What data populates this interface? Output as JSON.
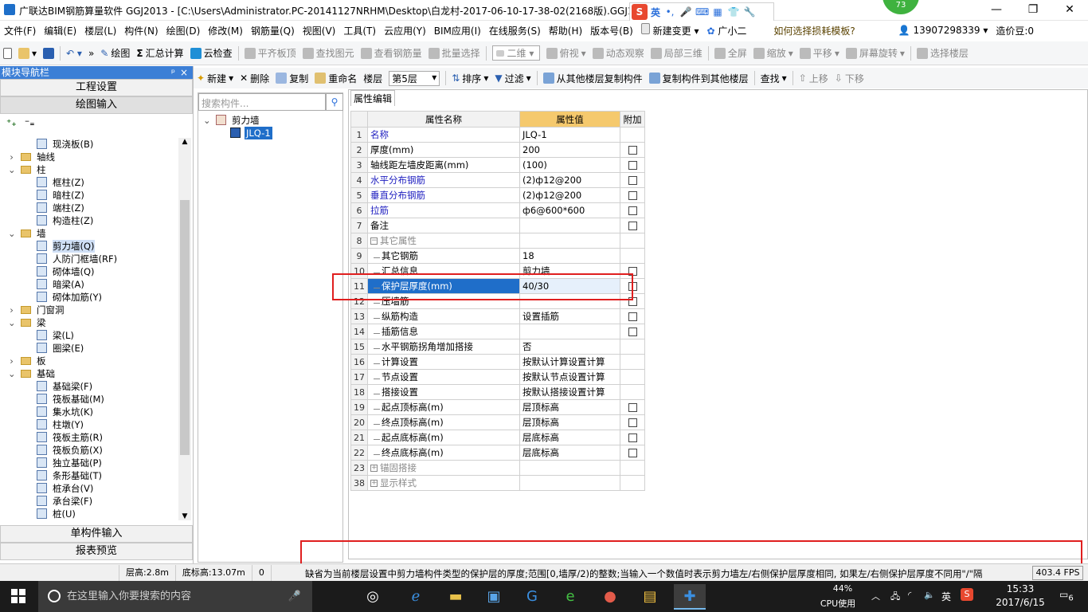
{
  "window": {
    "title": "广联达BIM钢筋算量软件 GGJ2013 - [C:\\Users\\Administrator.PC-20141127NRHM\\Desktop\\白龙村-2017-06-10-17-38-02(2168版).GGJ12]",
    "minimize": "—",
    "restore": "❐",
    "close": "✕"
  },
  "ime": {
    "logo": "S",
    "lang": "英"
  },
  "badge": {
    "value": "73"
  },
  "menu": {
    "items": [
      "文件(F)",
      "编辑(E)",
      "楼层(L)",
      "构件(N)",
      "绘图(D)",
      "修改(M)",
      "钢筋量(Q)",
      "视图(V)",
      "工具(T)",
      "云应用(Y)",
      "BIM应用(I)",
      "在线服务(S)",
      "帮助(H)",
      "版本号(B)"
    ],
    "new_change": "新建变更",
    "assistant": "广小二",
    "help_link": "如何选择损耗模板?",
    "phone": "13907298339",
    "coins": "造价豆:0"
  },
  "toolbar": {
    "draw": "绘图",
    "sum": "汇总计算",
    "cloud_check": "云检查",
    "flat_slab": "平齐板顶",
    "find_element": "查找图元",
    "view_rebar": "查看钢筋量",
    "batch_select": "批量选择",
    "view_2d": "二维",
    "top_view": "俯视",
    "dynamic_view": "动态观察",
    "local_3d": "局部三维",
    "fullscreen": "全屏",
    "zoom": "缩放",
    "pan": "平移",
    "rotate": "屏幕旋转",
    "select_floor": "选择楼层"
  },
  "nav": {
    "title": "模块导航栏",
    "pin": "ᵖ",
    "close": "×",
    "project_settings": "工程设置",
    "drawing_input": "绘图输入",
    "single_input": "单构件输入",
    "report_preview": "报表预览",
    "tree": [
      {
        "level": 2,
        "type": "comp",
        "label": "现浇板(B)"
      },
      {
        "level": 1,
        "type": "folder",
        "toggle": "›",
        "label": "轴线"
      },
      {
        "level": 1,
        "type": "folder",
        "toggle": "⌄",
        "label": "柱"
      },
      {
        "level": 2,
        "type": "comp",
        "label": "框柱(Z)"
      },
      {
        "level": 2,
        "type": "comp",
        "label": "暗柱(Z)"
      },
      {
        "level": 2,
        "type": "comp",
        "label": "端柱(Z)"
      },
      {
        "level": 2,
        "type": "comp",
        "label": "构造柱(Z)"
      },
      {
        "level": 1,
        "type": "folder",
        "toggle": "⌄",
        "label": "墙"
      },
      {
        "level": 2,
        "type": "comp",
        "label": "剪力墙(Q)",
        "selected": true
      },
      {
        "level": 2,
        "type": "comp",
        "label": "人防门框墙(RF)"
      },
      {
        "level": 2,
        "type": "comp",
        "label": "砌体墙(Q)"
      },
      {
        "level": 2,
        "type": "comp",
        "label": "暗梁(A)"
      },
      {
        "level": 2,
        "type": "comp",
        "label": "砌体加筋(Y)"
      },
      {
        "level": 1,
        "type": "folder",
        "toggle": "›",
        "label": "门窗洞"
      },
      {
        "level": 1,
        "type": "folder",
        "toggle": "⌄",
        "label": "梁"
      },
      {
        "level": 2,
        "type": "comp",
        "label": "梁(L)"
      },
      {
        "level": 2,
        "type": "comp",
        "label": "圈梁(E)"
      },
      {
        "level": 1,
        "type": "folder",
        "toggle": "›",
        "label": "板"
      },
      {
        "level": 1,
        "type": "folder",
        "toggle": "⌄",
        "label": "基础"
      },
      {
        "level": 2,
        "type": "comp",
        "label": "基础梁(F)"
      },
      {
        "level": 2,
        "type": "comp",
        "label": "筏板基础(M)"
      },
      {
        "level": 2,
        "type": "comp",
        "label": "集水坑(K)"
      },
      {
        "level": 2,
        "type": "comp",
        "label": "柱墩(Y)"
      },
      {
        "level": 2,
        "type": "comp",
        "label": "筏板主筋(R)"
      },
      {
        "level": 2,
        "type": "comp",
        "label": "筏板负筋(X)"
      },
      {
        "level": 2,
        "type": "comp",
        "label": "独立基础(P)"
      },
      {
        "level": 2,
        "type": "comp",
        "label": "条形基础(T)"
      },
      {
        "level": 2,
        "type": "comp",
        "label": "桩承台(V)"
      },
      {
        "level": 2,
        "type": "comp",
        "label": "承台梁(F)"
      },
      {
        "level": 2,
        "type": "comp",
        "label": "桩(U)"
      }
    ]
  },
  "actions": {
    "new": "新建",
    "delete": "删除",
    "copy": "复制",
    "rename": "重命名",
    "floor_label": "楼层",
    "floor_value": "第5层",
    "sort": "排序",
    "filter": "过滤",
    "copy_from": "从其他楼层复制构件",
    "copy_to": "复制构件到其他楼层",
    "find": "查找",
    "move_up": "上移",
    "move_down": "下移"
  },
  "component_list": {
    "search_placeholder": "搜索构件...",
    "group": "剪力墙",
    "item": "JLQ-1"
  },
  "properties": {
    "tab": "属性编辑",
    "headers": {
      "name": "属性名称",
      "value": "属性值",
      "extra": "附加"
    },
    "rows": [
      {
        "num": "1",
        "name": "名称",
        "value": "JLQ-1",
        "blue": true,
        "cb": false
      },
      {
        "num": "2",
        "name": "厚度(mm)",
        "value": "200",
        "cb": true
      },
      {
        "num": "3",
        "name": "轴线距左墙皮距离(mm)",
        "value": "(100)",
        "cb": true
      },
      {
        "num": "4",
        "name": "水平分布钢筋",
        "value": "(2)ф12@200",
        "blue": true,
        "cb": true
      },
      {
        "num": "5",
        "name": "垂直分布钢筋",
        "value": "(2)ф12@200",
        "blue": true,
        "cb": true
      },
      {
        "num": "6",
        "name": "拉筋",
        "value": "ф6@600*600",
        "blue": true,
        "cb": true
      },
      {
        "num": "7",
        "name": "备注",
        "value": "",
        "cb": true
      },
      {
        "num": "8",
        "name": "其它属性",
        "value": "",
        "group": "−",
        "gray": true
      },
      {
        "num": "9",
        "name": "其它钢筋",
        "value": "18",
        "indent": true
      },
      {
        "num": "10",
        "name": "汇总信息",
        "value": "剪力墙",
        "indent": true,
        "cb": true
      },
      {
        "num": "11",
        "name": "保护层厚度(mm)",
        "value": "40/30",
        "indent": true,
        "cb": true,
        "highlight": true
      },
      {
        "num": "12",
        "name": "压墙筋",
        "value": "",
        "indent": true,
        "cb": true
      },
      {
        "num": "13",
        "name": "纵筋构造",
        "value": "设置插筋",
        "indent": true,
        "cb": true
      },
      {
        "num": "14",
        "name": "插筋信息",
        "value": "",
        "indent": true,
        "cb": true
      },
      {
        "num": "15",
        "name": "水平钢筋拐角增加搭接",
        "value": "否",
        "indent": true
      },
      {
        "num": "16",
        "name": "计算设置",
        "value": "按默认计算设置计算",
        "indent": true
      },
      {
        "num": "17",
        "name": "节点设置",
        "value": "按默认节点设置计算",
        "indent": true
      },
      {
        "num": "18",
        "name": "搭接设置",
        "value": "按默认搭接设置计算",
        "indent": true
      },
      {
        "num": "19",
        "name": "起点顶标高(m)",
        "value": "层顶标高",
        "indent": true,
        "cb": true
      },
      {
        "num": "20",
        "name": "终点顶标高(m)",
        "value": "层顶标高",
        "indent": true,
        "cb": true
      },
      {
        "num": "21",
        "name": "起点底标高(m)",
        "value": "层底标高",
        "indent": true,
        "cb": true
      },
      {
        "num": "22",
        "name": "终点底标高(m)",
        "value": "层底标高",
        "indent": true,
        "cb": true
      },
      {
        "num": "23",
        "name": "锚固搭接",
        "value": "",
        "group": "+",
        "gray": true
      },
      {
        "num": "38",
        "name": "显示样式",
        "value": "",
        "group": "+",
        "gray": true
      }
    ]
  },
  "status": {
    "floor_height": "层高:2.8m",
    "bottom_elev": "底标高:13.07m",
    "zero": "0",
    "message": "缺省为当前楼层设置中剪力墙构件类型的保护层的厚度;范围[0,墙厚/2)的整数;当输入一个数值时表示剪力墙左/右侧保护层厚度相同, 如果左/右侧保护层厚度不同用\"/\"隔",
    "fps": "403.4 FPS"
  },
  "taskbar": {
    "search_placeholder": "在这里输入你要搜索的内容",
    "cpu_percent": "44%",
    "cpu_label": "CPU使用",
    "ime": "英",
    "time": "15:33",
    "date": "2017/6/15",
    "notifications": "6"
  },
  "colors": {
    "accent": "#1f6ec9",
    "header_orange": "#f5c96d",
    "annotation_red": "#e01f1f"
  }
}
